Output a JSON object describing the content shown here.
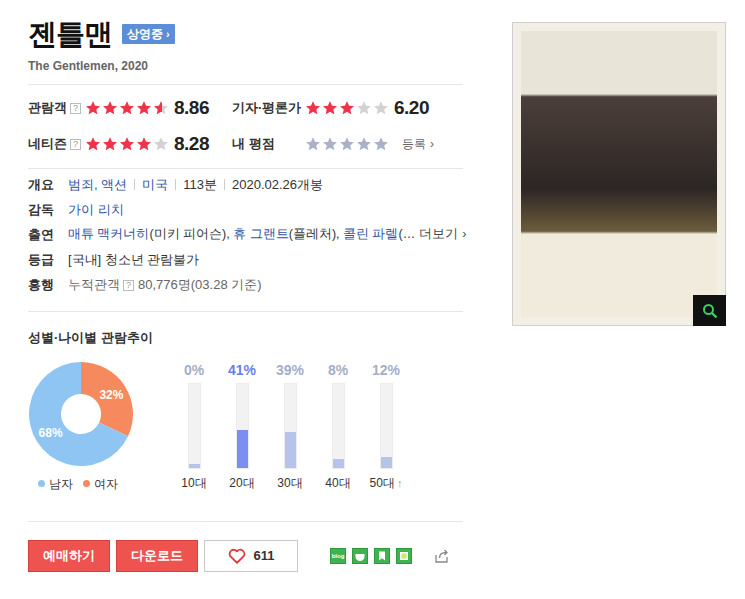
{
  "title": "젠틀맨",
  "status_badge": {
    "label": "상영중",
    "arrow": "›"
  },
  "subtitle": "The Gentlemen, 2020",
  "ratings": [
    {
      "kind": "score",
      "label": "관람객",
      "help": "?",
      "stars": 4.5,
      "score": "8.86"
    },
    {
      "kind": "score",
      "label": "기자·평론가",
      "stars": 3,
      "score": "6.20"
    },
    {
      "kind": "score",
      "label": "네티즌",
      "help": "?",
      "stars": 4,
      "score": "8.28"
    },
    {
      "kind": "mine",
      "label": "내 평점",
      "stars": 0,
      "action": "등록",
      "arrow": "›"
    }
  ],
  "info": [
    {
      "kind": "overview",
      "label": "개요",
      "parts": [
        {
          "text": "범죄, 액션",
          "link": true
        },
        {
          "text": "미국",
          "link": true
        },
        {
          "text": "113분",
          "link": false
        },
        {
          "text": "2020.02.26개봉",
          "link": false
        }
      ]
    },
    {
      "kind": "text",
      "label": "감독",
      "segments": [
        {
          "text": "가이 리치",
          "link": true
        }
      ]
    },
    {
      "kind": "cast",
      "label": "출연",
      "segments": [
        {
          "text": "매튜 맥커너히",
          "link": true
        },
        {
          "text": "(미키 피어슨), ",
          "link": false
        },
        {
          "text": "휴 그랜트",
          "link": true
        },
        {
          "text": "(플레처), ",
          "link": false
        },
        {
          "text": "콜린 파렐",
          "link": true
        },
        {
          "text": "(…",
          "link": false
        }
      ],
      "more": "더보기",
      "arrow": "›"
    },
    {
      "kind": "text",
      "label": "등급",
      "segments": [
        {
          "text": "[국내] 청소년 관람불가",
          "link": false
        }
      ]
    },
    {
      "kind": "boxoffice",
      "label": "흥행",
      "prefix": "누적관객",
      "help": "?",
      "value": "80,776명(03.28 기준)"
    }
  ],
  "chart": {
    "title": "성별·나이별 관람추이",
    "gender": [
      {
        "label": "남자",
        "value": "68%",
        "level": 0.68,
        "color": "#8ec5f2"
      },
      {
        "label": "여자",
        "value": "32%",
        "level": 0.32,
        "color": "#f68a5e"
      }
    ],
    "ages": [
      {
        "label": "10대",
        "value": "0%",
        "level": 0.05,
        "selected": false
      },
      {
        "label": "20대",
        "value": "41%",
        "level": 0.45,
        "selected": true
      },
      {
        "label": "30대",
        "value": "39%",
        "level": 0.43,
        "selected": false
      },
      {
        "label": "40대",
        "value": "8%",
        "level": 0.11,
        "selected": false
      },
      {
        "label": "50대",
        "value": "12%",
        "level": 0.13,
        "selected": false,
        "suffix": "↑"
      }
    ]
  },
  "buttons": [
    "예매하기",
    "다운로드"
  ],
  "like": {
    "count": "611"
  },
  "share": {
    "blog_label": "blog"
  }
}
